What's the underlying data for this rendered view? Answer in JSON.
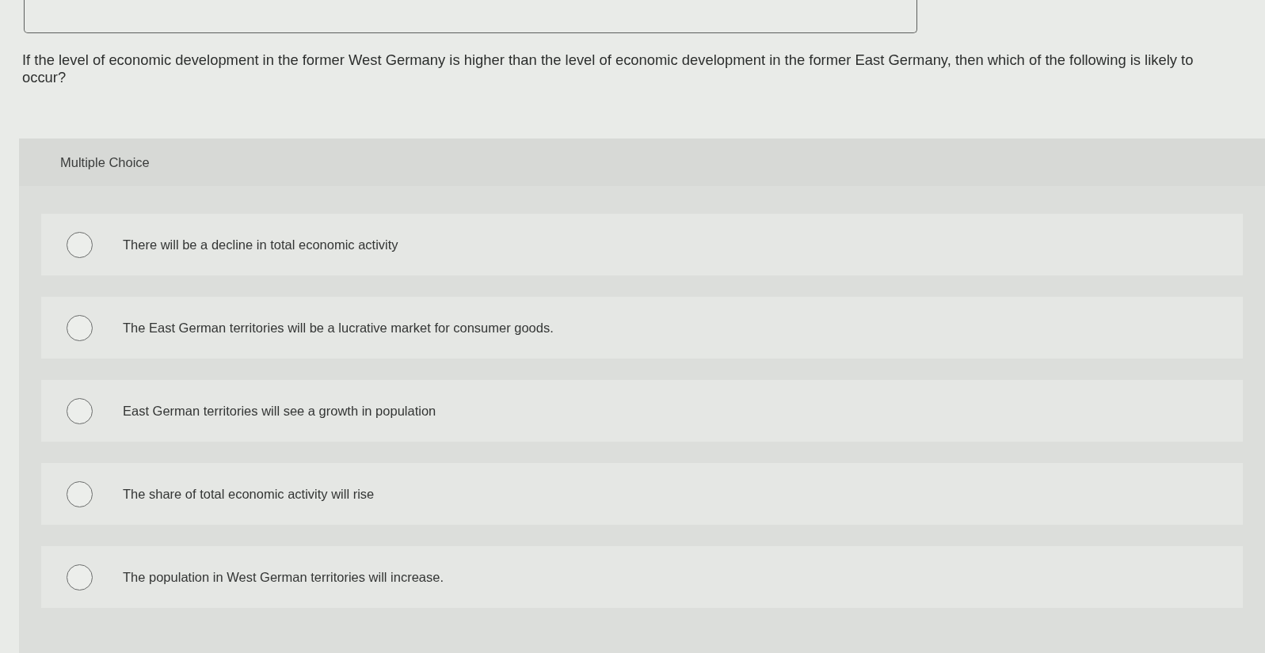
{
  "question": {
    "text": "If the level of economic development in the former West Germany is higher than the level of economic development in the former East Germany, then which of the following is likely to occur?"
  },
  "multiple_choice": {
    "heading": "Multiple Choice",
    "options": [
      {
        "label": "There will be a decline in total economic activity",
        "selected": false
      },
      {
        "label": "The East German territories will be a lucrative market for consumer goods.",
        "selected": false
      },
      {
        "label": "East German territories will see a growth in population",
        "selected": false
      },
      {
        "label": "The share of total economic activity will rise",
        "selected": false
      },
      {
        "label": "The population in West German territories will increase.",
        "selected": false
      }
    ]
  }
}
